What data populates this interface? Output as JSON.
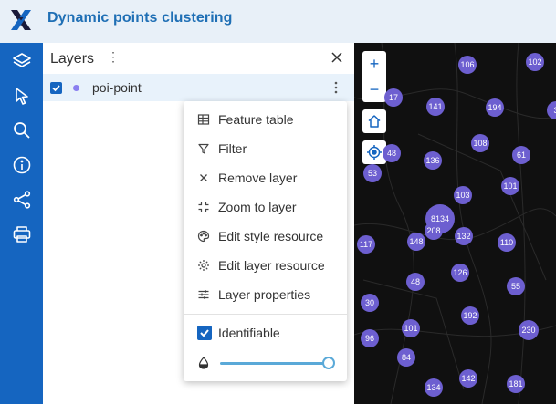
{
  "header": {
    "title": "Dynamic points clustering",
    "logo_icon": "x-logo-icon",
    "brand_color": "#1565c0"
  },
  "leftbar": {
    "items": [
      {
        "icon": "layers-icon"
      },
      {
        "icon": "cursor-select-icon"
      },
      {
        "icon": "search-icon"
      },
      {
        "icon": "info-icon"
      },
      {
        "icon": "share-icon"
      },
      {
        "icon": "print-icon"
      }
    ]
  },
  "panel": {
    "title": "Layers",
    "menu_glyph": "⋮",
    "layer": {
      "name": "poi-point",
      "checked": true,
      "color": "#8a7ff0"
    }
  },
  "context_menu": {
    "items": [
      {
        "label": "Feature table",
        "icon": "table-icon"
      },
      {
        "label": "Filter",
        "icon": "filter-icon"
      },
      {
        "label": "Remove layer",
        "icon": "close-icon"
      },
      {
        "label": "Zoom to layer",
        "icon": "zoom-to-extent-icon"
      },
      {
        "label": "Edit style resource",
        "icon": "palette-icon"
      },
      {
        "label": "Edit layer resource",
        "icon": "settings-icon"
      },
      {
        "label": "Layer properties",
        "icon": "sliders-icon"
      }
    ],
    "identifiable": {
      "label": "Identifiable",
      "checked": true
    },
    "opacity": 1.0
  },
  "map": {
    "zoom_in": "+",
    "zoom_out": "−",
    "cluster_color": "#6d5fd0",
    "clusters": [
      {
        "label": "106"
      },
      {
        "label": "102"
      },
      {
        "label": "17"
      },
      {
        "label": "141"
      },
      {
        "label": "194"
      },
      {
        "label": "3"
      },
      {
        "label": "48"
      },
      {
        "label": "136"
      },
      {
        "label": "108"
      },
      {
        "label": "61"
      },
      {
        "label": "53"
      },
      {
        "label": "101"
      },
      {
        "label": "103"
      },
      {
        "label": "8134"
      },
      {
        "label": "208"
      },
      {
        "label": "132"
      },
      {
        "label": "117"
      },
      {
        "label": "148"
      },
      {
        "label": "110"
      },
      {
        "label": "126"
      },
      {
        "label": "48"
      },
      {
        "label": "55"
      },
      {
        "label": "30"
      },
      {
        "label": "192"
      },
      {
        "label": "101"
      },
      {
        "label": "230"
      },
      {
        "label": "96"
      },
      {
        "label": "84"
      },
      {
        "label": "142"
      },
      {
        "label": "134"
      },
      {
        "label": "181"
      }
    ]
  }
}
